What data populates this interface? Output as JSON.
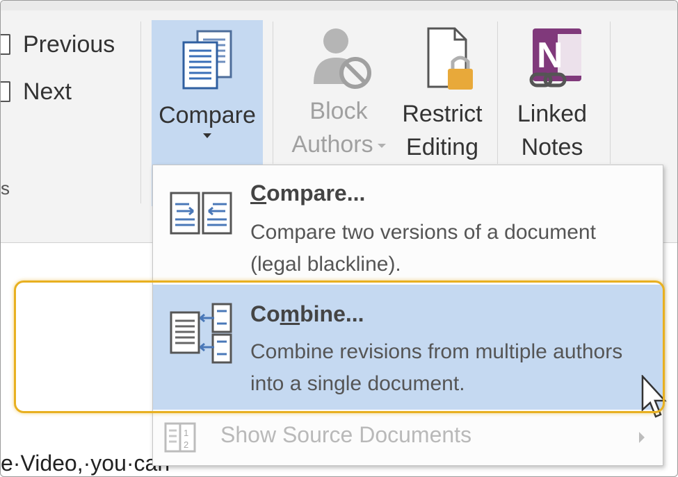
{
  "ribbon": {
    "navigation": {
      "previous_label": "Previous",
      "next_label": "Next",
      "group_label_fragment": "s"
    },
    "compare_button": {
      "label": "Compare"
    },
    "block_authors_button": {
      "line1": "Block",
      "line2": "Authors"
    },
    "restrict_editing_button": {
      "line1": "Restrict",
      "line2": "Editing"
    },
    "linked_notes_button": {
      "line1": "Linked",
      "line2": "Notes"
    }
  },
  "compare_menu": {
    "compare_item": {
      "title_prefix": "",
      "title_underlined": "C",
      "title_suffix": "ompare...",
      "description": "Compare two versions of a document (legal blackline)."
    },
    "combine_item": {
      "title_prefix": "Co",
      "title_underlined": "m",
      "title_suffix": "bine...",
      "description": "Combine revisions from multiple authors into a single document."
    },
    "show_source_item": {
      "label": "Show Source Documents"
    }
  },
  "document": {
    "visible_text": "e·Video,·you·can"
  },
  "colors": {
    "accent_selected": "#c5d9f1",
    "highlight_ring": "#e8b020",
    "onenote_purple": "#80397b",
    "lock_gold": "#e8a93a"
  }
}
